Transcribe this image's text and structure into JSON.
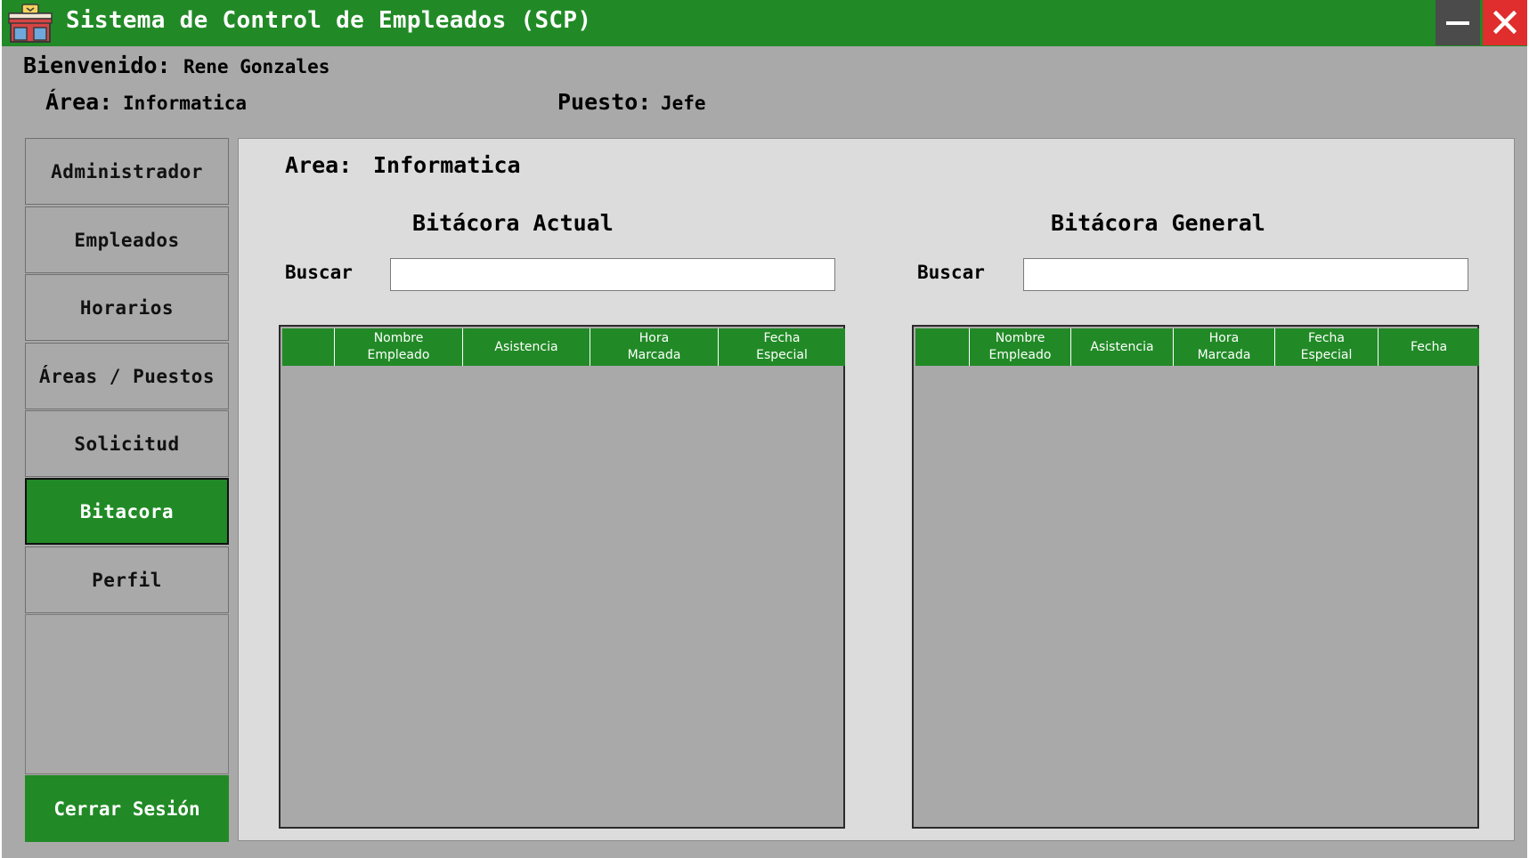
{
  "window": {
    "title": "Sistema de Control de Empleados (SCP)",
    "app_icon": "store-icon",
    "colors": {
      "accent": "#218a26",
      "close": "#e02e2e",
      "minimize": "#4b4b4b",
      "panel": "#a9a9a9",
      "content": "#dcdcdc"
    }
  },
  "header": {
    "welcome_label": "Bienvenido:",
    "user_name": "Rene Gonzales",
    "area_label": "Área:",
    "area_value": "Informatica",
    "position_label": "Puesto:",
    "position_value": "Jefe"
  },
  "sidebar": {
    "items": [
      {
        "label": "Administrador",
        "active": false
      },
      {
        "label": "Empleados",
        "active": false
      },
      {
        "label": "Horarios",
        "active": false
      },
      {
        "label": "Áreas / Puestos",
        "active": false
      },
      {
        "label": "Solicitud",
        "active": false
      },
      {
        "label": "Bitacora",
        "active": true
      },
      {
        "label": "Perfil",
        "active": false
      }
    ],
    "logout_label": "Cerrar Sesión"
  },
  "main": {
    "area_label": "Area:",
    "area_value": "Informatica",
    "current_log": {
      "title": "Bitácora Actual",
      "search_label": "Buscar",
      "search_value": "",
      "columns": [
        "",
        "Nombre\nEmpleado",
        "Asistencia",
        "Hora\nMarcada",
        "Fecha\nEspecial"
      ],
      "rows": []
    },
    "general_log": {
      "title": "Bitácora General",
      "search_label": "Buscar",
      "search_value": "",
      "columns": [
        "",
        "Nombre\nEmpleado",
        "Asistencia",
        "Hora\nMarcada",
        "Fecha\nEspecial",
        "Fecha"
      ],
      "rows": []
    }
  }
}
